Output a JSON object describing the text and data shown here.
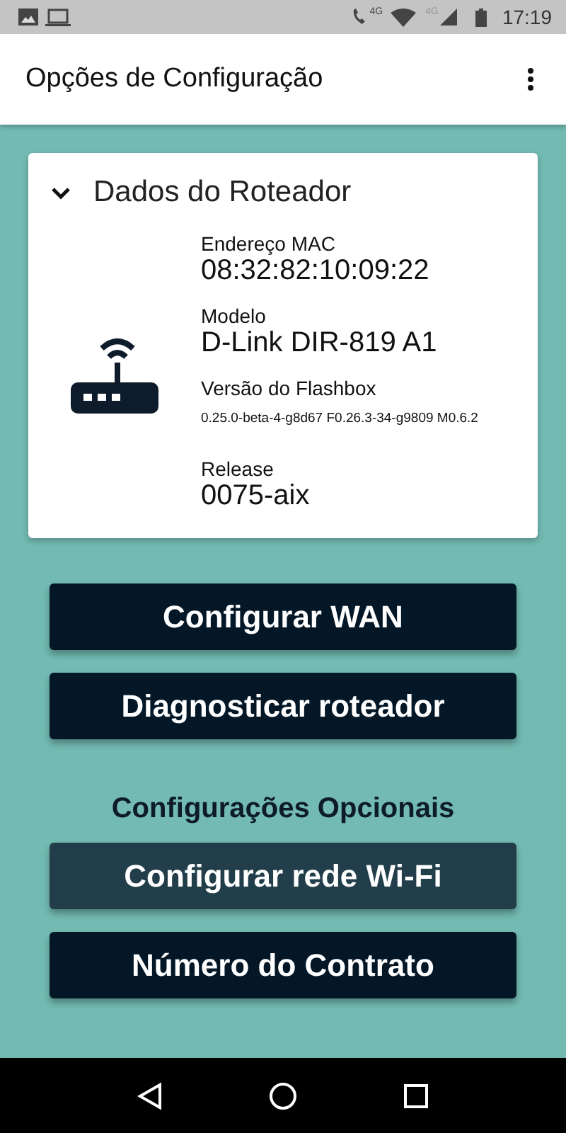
{
  "status_bar": {
    "call_network": "4G",
    "cell_network": "4G",
    "time": "17:19"
  },
  "app_bar": {
    "title": "Opções de Configuração"
  },
  "router_card": {
    "title": "Dados do Roteador",
    "expanded": true,
    "fields": [
      {
        "label": "Endereço MAC",
        "value": "08:32:82:10:09:22",
        "kind": "large"
      },
      {
        "label": "Modelo",
        "value": "D-Link DIR-819 A1",
        "kind": "large"
      },
      {
        "label": "Versão do Flashbox",
        "value": "0.25.0-beta-4-g8d67 F0.26.3-34-g9809 M0.6.2",
        "kind": "small"
      },
      {
        "label": "Release",
        "value": "0075-aix",
        "kind": "large"
      }
    ]
  },
  "actions": [
    {
      "label": "Configurar WAN",
      "selected": false
    },
    {
      "label": "Diagnosticar roteador",
      "selected": false
    }
  ],
  "optional_section": {
    "title": "Configurações Opcionais"
  },
  "optional_actions": [
    {
      "label": "Configurar rede Wi-Fi",
      "selected": true
    },
    {
      "label": "Número do Contrato",
      "selected": false
    }
  ]
}
